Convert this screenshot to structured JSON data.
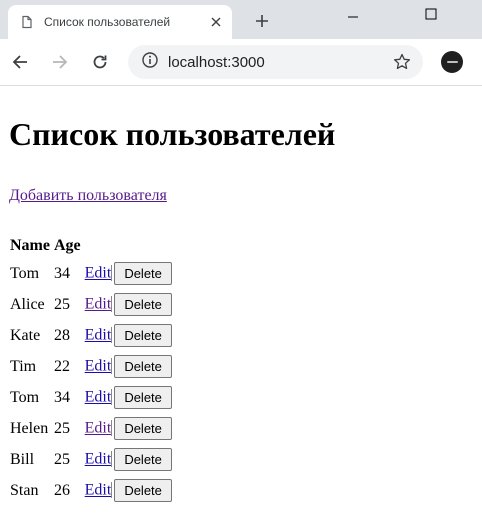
{
  "browser": {
    "tab_title": "Список пользователей",
    "url": "localhost:3000"
  },
  "page": {
    "heading": "Список пользователей",
    "add_link": "Добавить пользователя",
    "table": {
      "headers": [
        "Name",
        "Age"
      ],
      "rows": [
        {
          "name": "Tom",
          "age": "34",
          "edit": "Edit",
          "edit_visited": false,
          "delete": "Delete"
        },
        {
          "name": "Alice",
          "age": "25",
          "edit": "Edit",
          "edit_visited": true,
          "delete": "Delete"
        },
        {
          "name": "Kate",
          "age": "28",
          "edit": "Edit",
          "edit_visited": false,
          "delete": "Delete"
        },
        {
          "name": "Tim",
          "age": "22",
          "edit": "Edit",
          "edit_visited": false,
          "delete": "Delete"
        },
        {
          "name": "Tom",
          "age": "34",
          "edit": "Edit",
          "edit_visited": false,
          "delete": "Delete"
        },
        {
          "name": "Helen",
          "age": "25",
          "edit": "Edit",
          "edit_visited": true,
          "delete": "Delete"
        },
        {
          "name": "Bill",
          "age": "25",
          "edit": "Edit",
          "edit_visited": false,
          "delete": "Delete"
        },
        {
          "name": "Stan",
          "age": "26",
          "edit": "Edit",
          "edit_visited": false,
          "delete": "Delete"
        }
      ]
    }
  },
  "colors": {
    "link": "#1a0dab",
    "visited_link": "#551a8b",
    "tabstrip": "#dee1e6"
  },
  "icons": [
    "page-icon",
    "close-icon",
    "plus-icon",
    "minimize-icon",
    "maximize-icon",
    "back-arrow-icon",
    "forward-arrow-icon",
    "reload-icon",
    "info-icon",
    "star-icon",
    "profile-avatar-icon"
  ]
}
